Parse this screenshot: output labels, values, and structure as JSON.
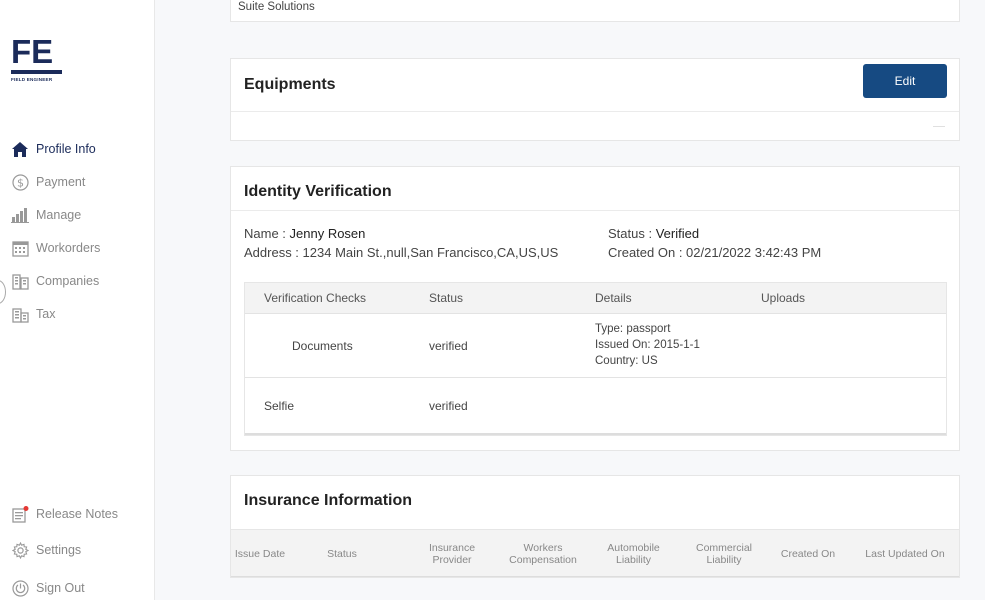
{
  "sidebar": {
    "logo_text": "FE",
    "logo_subtitle": "FIELD ENGINEER",
    "items": [
      {
        "label": "Profile Info",
        "icon": "home-icon"
      },
      {
        "label": "Payment",
        "icon": "dollar-icon"
      },
      {
        "label": "Manage",
        "icon": "chart-icon"
      },
      {
        "label": "Workorders",
        "icon": "calendar-icon"
      },
      {
        "label": "Companies",
        "icon": "building-icon"
      },
      {
        "label": "Tax",
        "icon": "tax-icon"
      }
    ],
    "bottom_items": [
      {
        "label": "Release Notes",
        "icon": "notes-icon"
      },
      {
        "label": "Settings",
        "icon": "gear-icon"
      },
      {
        "label": "Sign Out",
        "icon": "power-icon"
      }
    ]
  },
  "top_card": {
    "text": "Suite Solutions"
  },
  "equipments": {
    "title": "Equipments",
    "edit_label": "Edit"
  },
  "identity": {
    "title": "Identity Verification",
    "name_label": "Name : ",
    "name_value": "Jenny Rosen",
    "address_label": "Address : ",
    "address_value": "1234 Main St.,null,San Francisco,CA,US,US",
    "status_label": "Status : ",
    "status_value": "Verified",
    "created_label": "Created On : ",
    "created_value": "02/21/2022 3:42:43 PM",
    "table": {
      "headers": [
        "Verification Checks",
        "Status",
        "Details",
        "Uploads"
      ],
      "rows": [
        {
          "check": "Documents",
          "status": "verified",
          "details": [
            "Type: passport",
            "Issued On: 2015-1-1",
            "Country: US"
          ]
        },
        {
          "check": "Selfie",
          "status": "verified",
          "details": []
        }
      ]
    }
  },
  "insurance": {
    "title": "Insurance Information",
    "columns": [
      "Issue Date",
      "Status",
      "Insurance Provider",
      "Workers Compensation",
      "Automobile Liability",
      "Commercial Liability",
      "Created On",
      "Last Updated On"
    ]
  },
  "colors": {
    "brand_navy": "#1b2b5a",
    "button_blue": "#164a82",
    "notification_red": "#e53935"
  }
}
